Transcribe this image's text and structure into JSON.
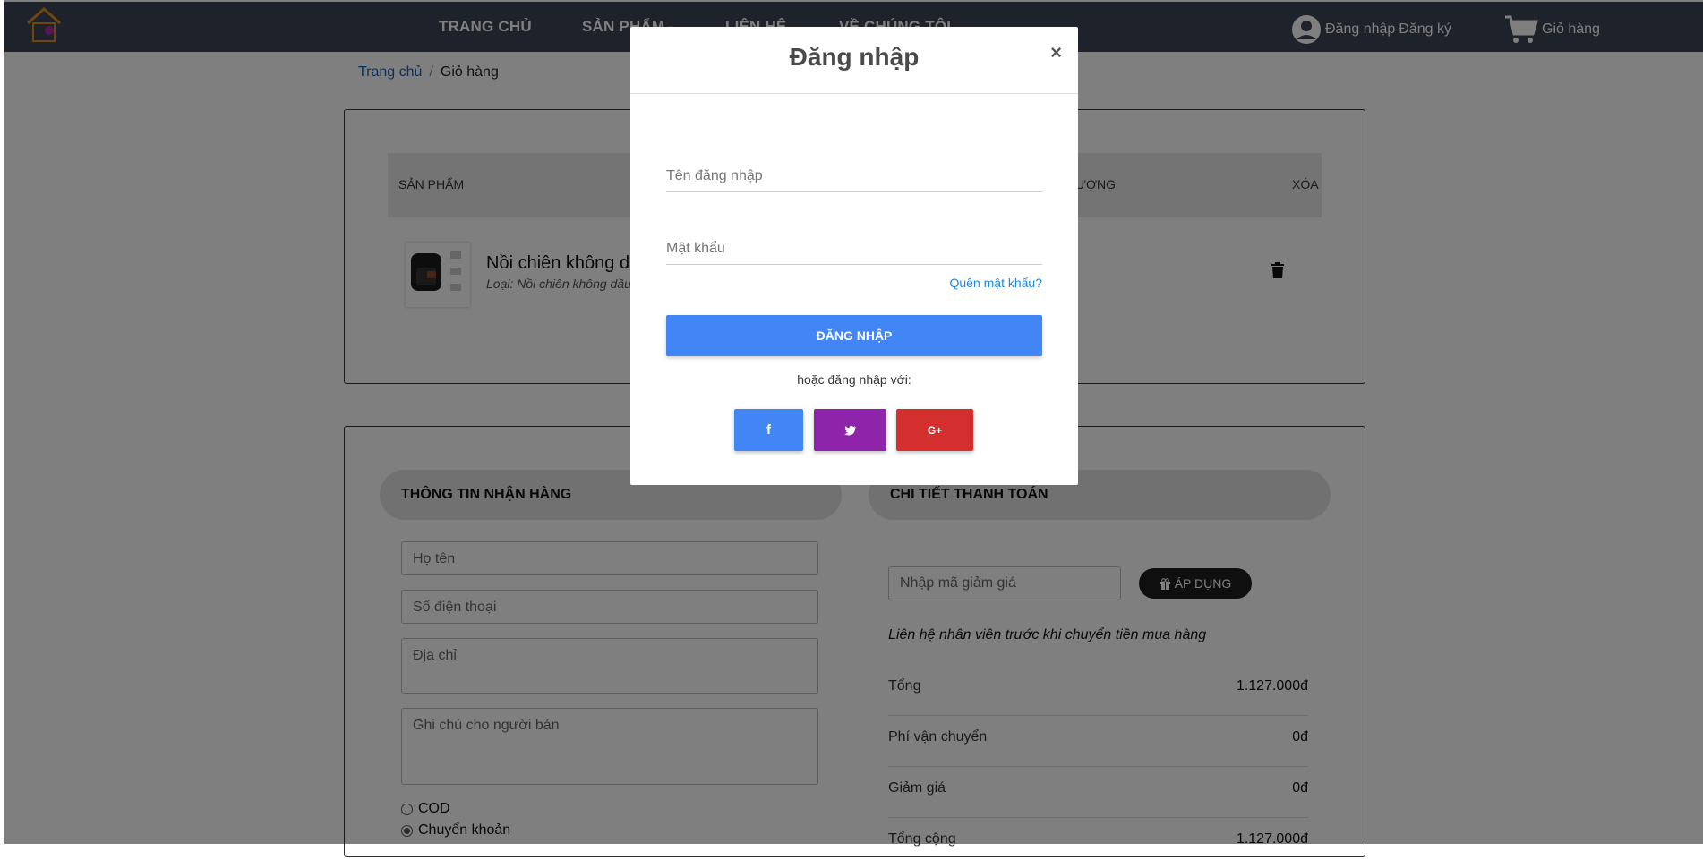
{
  "navbar": {
    "links": [
      "TRANG CHỦ",
      "SẢN PHẨM",
      "LIÊN HỆ",
      "VỀ CHÚNG TÔI"
    ],
    "auth": {
      "login": "Đăng nhập",
      "register": "Đăng ký"
    },
    "cart_label": "Giỏ hàng"
  },
  "breadcrumb": {
    "home": "Trang chủ",
    "sep": "/",
    "current": "Giỏ hàng"
  },
  "cart_table": {
    "headers": {
      "product": "SẢN PHẨM",
      "quantity_partial": "ƯỢNG",
      "delete": "XÓA"
    },
    "item": {
      "name": "Nồi chiên không d",
      "type": "Loại: Nồi chiên không dầu"
    }
  },
  "shipping": {
    "title": "THÔNG TIN NHẬN HÀNG",
    "name_placeholder": "Họ tên",
    "phone_placeholder": "Số điện thoại",
    "address_placeholder": "Địa chỉ",
    "note_placeholder": "Ghi chú cho người bán",
    "payment_options": [
      "COD",
      "Chuyển khoản"
    ],
    "selected_payment": "Chuyển khoản"
  },
  "payment": {
    "title": "CHI TIẾT THANH TOÁN",
    "coupon_placeholder": "Nhập mã giảm giá",
    "apply_label": "ÁP DỤNG",
    "note": "Liên hệ nhân viên trước khi chuyển tiền mua hàng",
    "rows": [
      {
        "label": "Tổng",
        "value": "1.127.000đ"
      },
      {
        "label": "Phí vận chuyển",
        "value": "0đ"
      },
      {
        "label": "Giảm giá",
        "value": "0đ"
      },
      {
        "label": "Tổng cộng",
        "value": "1.127.000đ"
      }
    ]
  },
  "login_modal": {
    "title": "Đăng nhập",
    "close": "×",
    "username_placeholder": "Tên đăng nhập",
    "password_placeholder": "Mật khẩu",
    "forgot": "Quên mật khẩu?",
    "submit": "ĐĂNG NHẬP",
    "or_text": "hoặc đăng nhập với:",
    "social": [
      {
        "icon": "facebook-icon",
        "glyph": "f",
        "color": "#4285f4"
      },
      {
        "icon": "twitter-icon",
        "glyph": "🐦",
        "color": "#8e24aa"
      },
      {
        "icon": "google-plus-icon",
        "glyph": "G+",
        "color": "#d32f2f"
      }
    ]
  },
  "colors": {
    "navbar": "#3a4556",
    "primary": "#4285f4",
    "link": "#1e88e5"
  }
}
